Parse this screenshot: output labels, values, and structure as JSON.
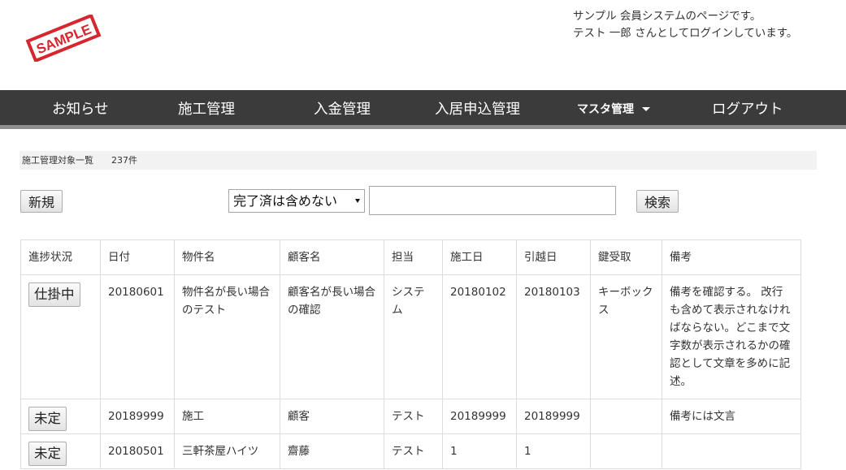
{
  "header": {
    "logo_text": "SAMPLE",
    "info_line1": "サンプル 会員システムのページです。",
    "info_line2": "テスト 一郎 さんとしてログインしています。"
  },
  "nav": {
    "items": [
      "お知らせ",
      "施工管理",
      "入金管理",
      "入居申込管理",
      "マスタ管理",
      "ログアウト"
    ]
  },
  "summary": {
    "title": "施工管理対象一覧",
    "count": "237件"
  },
  "toolbar": {
    "new_label": "新規",
    "filter_selected": "完了済は含めない",
    "search_value": "",
    "search_label": "検索"
  },
  "table": {
    "headers": [
      "進捗状況",
      "日付",
      "物件名",
      "顧客名",
      "担当",
      "施工日",
      "引越日",
      "鍵受取",
      "備考"
    ],
    "rows": [
      [
        "仕掛中",
        "20180601",
        "物件名が長い場合のテスト",
        "顧客名が長い場合の確認",
        "システム",
        "20180102",
        "20180103",
        "キーボックス",
        "備考を確認する。 改行も含めて表示されなければならない。どこまで文字数が表示されるかの確認として文章を多めに記述。"
      ],
      [
        "未定",
        "20189999",
        "施工",
        "顧客",
        "テスト",
        "20189999",
        "20189999",
        "",
        "備考には文言"
      ],
      [
        "未定",
        "20180501",
        "三軒茶屋ハイツ",
        "齋藤",
        "テスト",
        "1",
        "1",
        "",
        ""
      ]
    ]
  },
  "colors": {
    "nav_bg": "#3b3b3b",
    "nav_border": "#8e8e8e",
    "stamp_red": "#d7262f",
    "summary_bg": "#f2f2f2"
  }
}
